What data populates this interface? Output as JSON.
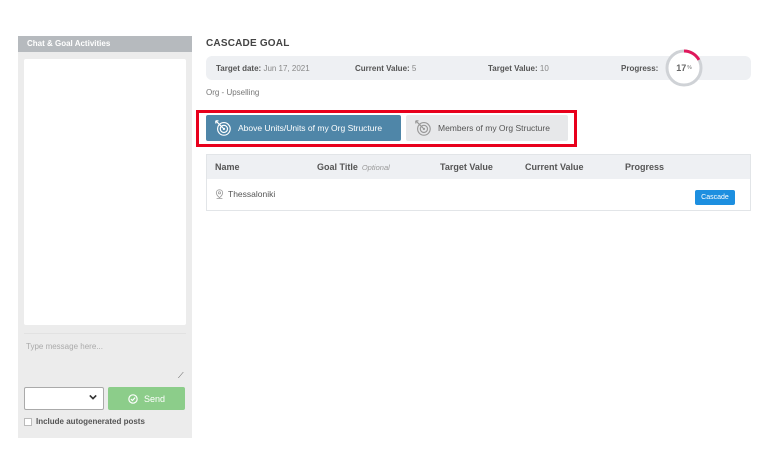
{
  "chat": {
    "header": "Chat & Goal Activities",
    "input_placeholder": "Type message here...",
    "channel_value": "",
    "send_label": "Send",
    "autogen_label": "Include autogenerated posts"
  },
  "page": {
    "title": "CASCADE GOAL",
    "breadcrumb": "Org - Upselling"
  },
  "summary": {
    "target_date_label": "Target date:",
    "target_date_value": "Jun 17, 2021",
    "current_value_label": "Current Value:",
    "current_value_value": "5",
    "target_value_label": "Target Value:",
    "target_value_value": "10",
    "progress_label": "Progress:",
    "progress_value": "17",
    "progress_unit": "%",
    "progress_fraction": 0.17
  },
  "tabs": [
    {
      "label": "Above Units/Units of my Org Structure",
      "active": true
    },
    {
      "label": "Members of my Org Structure",
      "active": false
    }
  ],
  "table": {
    "headers": {
      "name": "Name",
      "goal_title": "Goal Title",
      "goal_title_hint": "Optional",
      "target_value": "Target Value",
      "current_value": "Current Value",
      "progress": "Progress"
    },
    "rows": [
      {
        "name": "Thessaloniki",
        "action": "Cascade"
      }
    ]
  },
  "colors": {
    "active_tab": "#4f86a8",
    "highlight": "#e8001c",
    "send_button": "#8ccd8a",
    "cascade_button": "#1d8fe0",
    "progress_arc": "#e0185c"
  }
}
